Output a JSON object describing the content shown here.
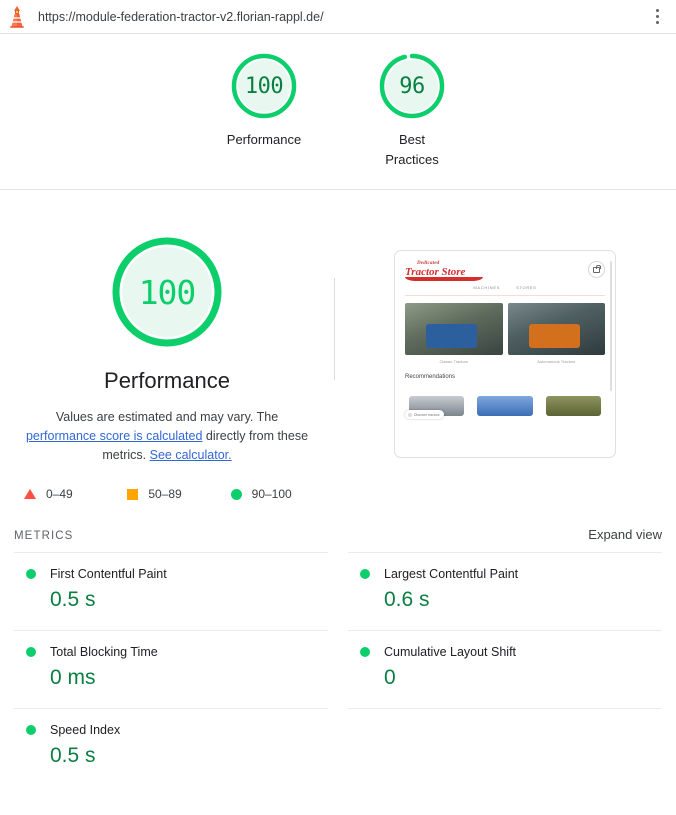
{
  "urlbar": {
    "icon": "lighthouse-icon",
    "url": "https://module-federation-tractor-v2.florian-rappl.de/",
    "menu_icon": "kebab-menu-icon"
  },
  "summary": {
    "gauges": [
      {
        "score": "100",
        "value": 100,
        "label": "Performance",
        "color": "#0cce6b"
      },
      {
        "score": "96",
        "value": 96,
        "label": "Best Practices",
        "color": "#0cce6b"
      }
    ]
  },
  "performance": {
    "score": "100",
    "value": 100,
    "title": "Performance",
    "description_part1": "Values are estimated and may vary. The ",
    "link1": "performance score is calculated",
    "description_part2": " directly from these metrics. ",
    "link2": "See calculator.",
    "colors": {
      "pass": "#0cce6b",
      "average": "#ffa400",
      "fail": "#ff4e42",
      "link": "#3367d6"
    }
  },
  "legend": [
    {
      "shape": "triangle",
      "range": "0–49",
      "color": "#ff4e42"
    },
    {
      "shape": "square",
      "range": "50–89",
      "color": "#ffa400"
    },
    {
      "shape": "circle",
      "range": "90–100",
      "color": "#0cce6b"
    }
  ],
  "thumbnail": {
    "logo_top": "Dedicated",
    "logo_main": "Tractor Store",
    "cart_icon": "cart-icon",
    "nav": [
      "MACHINES",
      "STORES"
    ],
    "heroes": [
      {
        "caption": "Classic Tractors"
      },
      {
        "caption": "Autonomous Tractors"
      }
    ],
    "section_title": "Recommendations",
    "badge": "Discover tractors"
  },
  "metrics_section": {
    "title": "METRICS",
    "expand_label": "Expand view",
    "items": [
      {
        "name": "First Contentful Paint",
        "value": "0.5 s",
        "status": "pass"
      },
      {
        "name": "Largest Contentful Paint",
        "value": "0.6 s",
        "status": "pass"
      },
      {
        "name": "Total Blocking Time",
        "value": "0 ms",
        "status": "pass"
      },
      {
        "name": "Cumulative Layout Shift",
        "value": "0",
        "status": "pass"
      },
      {
        "name": "Speed Index",
        "value": "0.5 s",
        "status": "pass"
      }
    ]
  }
}
